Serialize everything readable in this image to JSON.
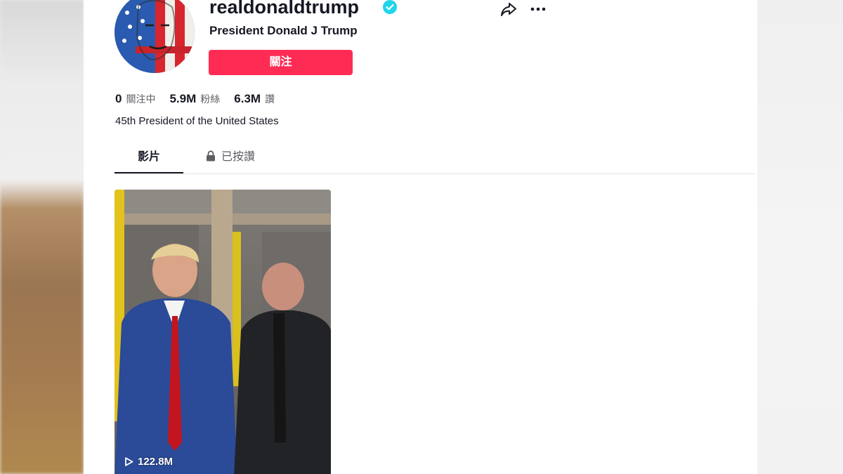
{
  "profile": {
    "username": "realdonaldtrump",
    "nickname": "President Donald J Trump",
    "follow_label": "關注",
    "bio": "45th President of the United States"
  },
  "stats": {
    "following": {
      "value": "0",
      "label": "關注中"
    },
    "followers": {
      "value": "5.9M",
      "label": "粉絲"
    },
    "likes": {
      "value": "6.3M",
      "label": "讚"
    }
  },
  "tabs": {
    "videos": "影片",
    "liked": "已按讚"
  },
  "videos": [
    {
      "views": "122.8M"
    }
  ],
  "colors": {
    "follow_button": "#fe2c55",
    "verified": "#20d5ec",
    "text_primary": "#161823",
    "text_secondary": "#5e5e63"
  },
  "icons": [
    "verified-badge-icon",
    "share-icon",
    "more-icon",
    "lock-icon",
    "play-icon"
  ]
}
